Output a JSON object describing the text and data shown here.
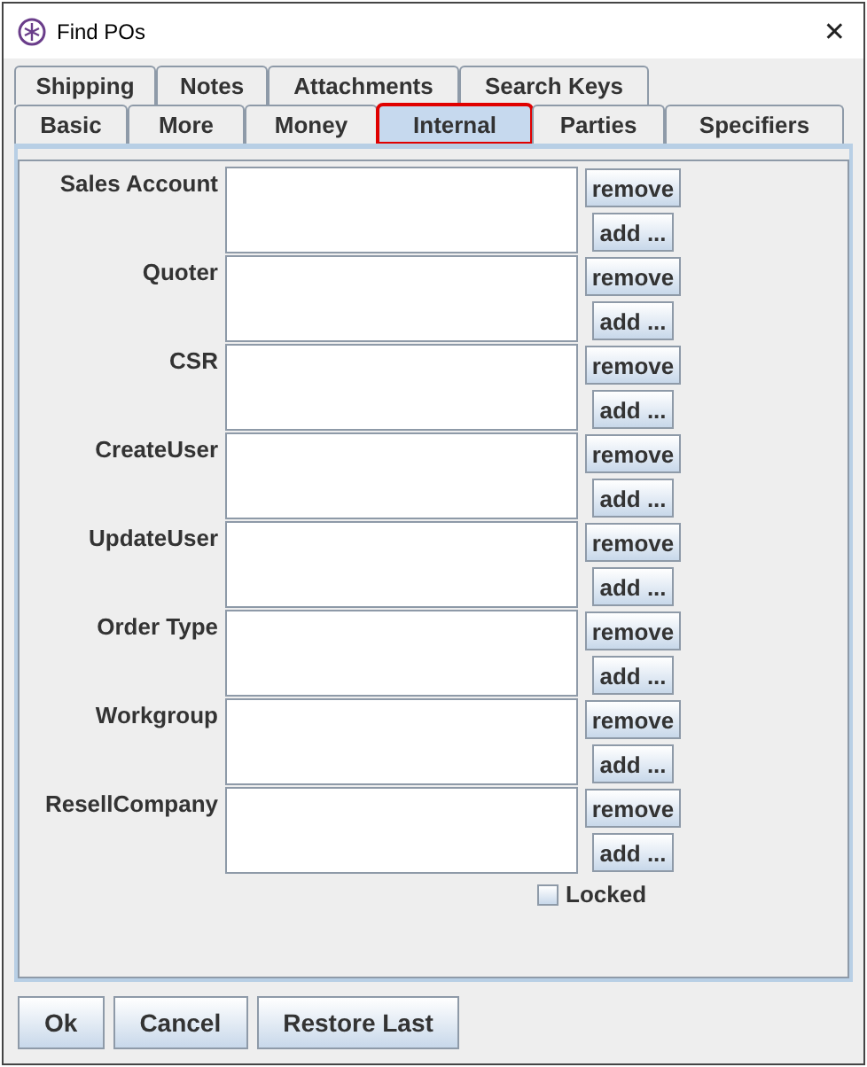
{
  "window": {
    "title": "Find POs",
    "close": "✕"
  },
  "tab_rows": [
    [
      {
        "label": "Shipping",
        "selected": false
      },
      {
        "label": "Notes",
        "selected": false
      },
      {
        "label": "Attachments",
        "selected": false
      },
      {
        "label": "Search Keys",
        "selected": false
      }
    ],
    [
      {
        "label": "Basic",
        "selected": false
      },
      {
        "label": "More",
        "selected": false
      },
      {
        "label": "Money",
        "selected": false
      },
      {
        "label": "Internal",
        "selected": true
      },
      {
        "label": "Parties",
        "selected": false
      },
      {
        "label": "Specifiers",
        "selected": false
      }
    ]
  ],
  "fields": [
    {
      "label": "Sales Account",
      "remove": "remove",
      "add": "add ..."
    },
    {
      "label": "Quoter",
      "remove": "remove",
      "add": "add ..."
    },
    {
      "label": "CSR",
      "remove": "remove",
      "add": "add ..."
    },
    {
      "label": "CreateUser",
      "remove": "remove",
      "add": "add ..."
    },
    {
      "label": "UpdateUser",
      "remove": "remove",
      "add": "add ..."
    },
    {
      "label": "Order Type",
      "remove": "remove",
      "add": "add ..."
    },
    {
      "label": "Workgroup",
      "remove": "remove",
      "add": "add ..."
    },
    {
      "label": "ResellCompany",
      "remove": "remove",
      "add": "add ..."
    }
  ],
  "locked": {
    "label": "Locked",
    "checked": false
  },
  "buttons": [
    "Ok",
    "Cancel",
    "Restore Last"
  ]
}
